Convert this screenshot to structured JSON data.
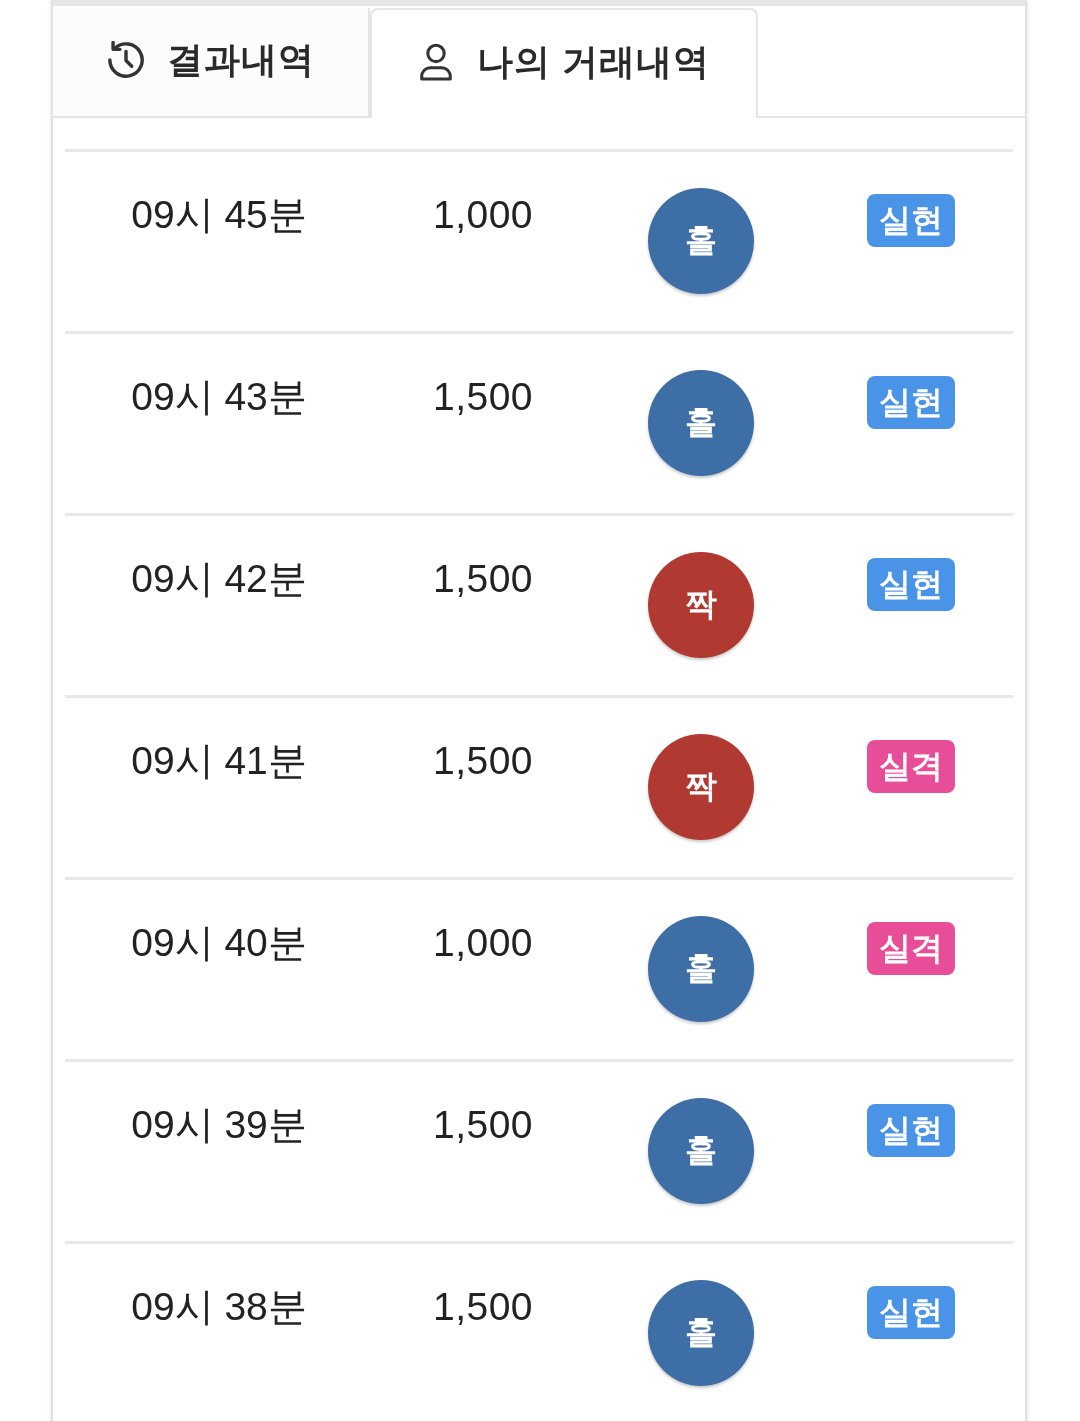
{
  "tabs": [
    {
      "label": "결과내역",
      "kind": "history",
      "selected": false
    },
    {
      "label": "나의 거래내역",
      "kind": "account",
      "selected": true
    }
  ],
  "rows": [
    {
      "time": "09시 45분",
      "amount": "1,000",
      "result": {
        "label": "홀",
        "color": "#3d6ea6"
      },
      "status": {
        "label": "실현",
        "color": "#4a94e8"
      }
    },
    {
      "time": "09시 43분",
      "amount": "1,500",
      "result": {
        "label": "홀",
        "color": "#3d6ea6"
      },
      "status": {
        "label": "실현",
        "color": "#4a94e8"
      }
    },
    {
      "time": "09시 42분",
      "amount": "1,500",
      "result": {
        "label": "짝",
        "color": "#b03a32"
      },
      "status": {
        "label": "실현",
        "color": "#4a94e8"
      }
    },
    {
      "time": "09시 41분",
      "amount": "1,500",
      "result": {
        "label": "짝",
        "color": "#b03a32"
      },
      "status": {
        "label": "실격",
        "color": "#e84d98"
      }
    },
    {
      "time": "09시 40분",
      "amount": "1,000",
      "result": {
        "label": "홀",
        "color": "#3d6ea6"
      },
      "status": {
        "label": "실격",
        "color": "#e84d98"
      }
    },
    {
      "time": "09시 39분",
      "amount": "1,500",
      "result": {
        "label": "홀",
        "color": "#3d6ea6"
      },
      "status": {
        "label": "실현",
        "color": "#4a94e8"
      }
    },
    {
      "time": "09시 38분",
      "amount": "1,500",
      "result": {
        "label": "홀",
        "color": "#3d6ea6"
      },
      "status": {
        "label": "실현",
        "color": "#4a94e8"
      }
    }
  ]
}
